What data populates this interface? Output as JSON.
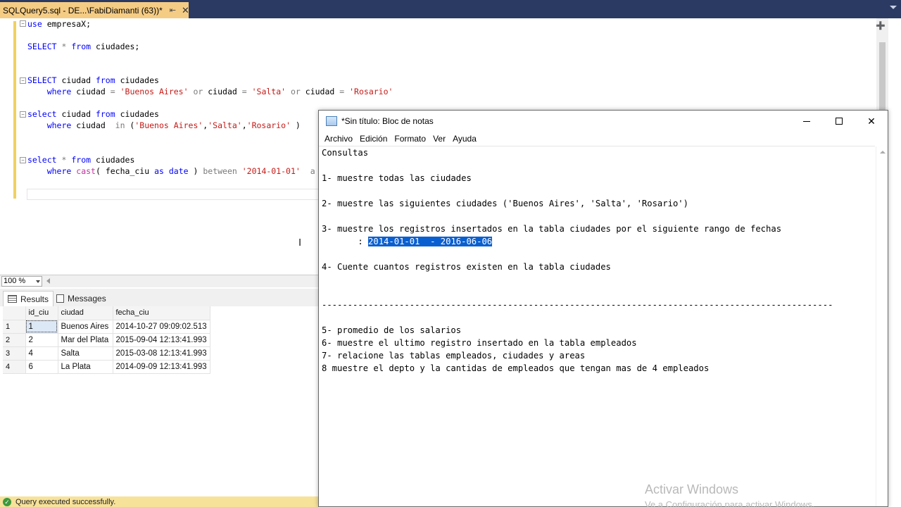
{
  "ssms": {
    "tab_title": "SQLQuery5.sql - DE...\\FabiDiamanti (63))*",
    "tab_pin": "⇤",
    "tab_close": "✕",
    "split_glyph": "➕",
    "code_lines": [
      "use empresaX;",
      "SELECT * from ciudades;",
      "SELECT ciudad from ciudades",
      "where ciudad = 'Buenos Aires' or ciudad = 'Salta' or ciudad = 'Rosario'",
      "select ciudad from ciudades",
      "where ciudad  in ('Buenos Aires','Salta','Rosario' )",
      "select * from ciudades",
      "where cast( fecha_ciu as date ) between '2014-01-01'  a"
    ],
    "zoom": "100 %",
    "results_tab": "Results",
    "messages_tab": "Messages",
    "grid": {
      "columns": [
        "id_ciu",
        "ciudad",
        "fecha_ciu"
      ],
      "rows": [
        {
          "n": "1",
          "id": "1",
          "ciudad": "Buenos Aires",
          "fecha": "2014-10-27 09:09:02.513"
        },
        {
          "n": "2",
          "id": "2",
          "ciudad": "Mar del Plata",
          "fecha": "2015-09-04 12:13:41.993"
        },
        {
          "n": "3",
          "id": "4",
          "ciudad": "Salta",
          "fecha": "2015-03-08 12:13:41.993"
        },
        {
          "n": "4",
          "id": "6",
          "ciudad": "La Plata",
          "fecha": "2014-09-09 12:13:41.993"
        }
      ]
    },
    "status": "Query executed successfully."
  },
  "notepad": {
    "title": "*Sin título: Bloc de notas",
    "menu": [
      "Archivo",
      "Edición",
      "Formato",
      "Ver",
      "Ayuda"
    ],
    "lines": [
      "Consultas",
      "",
      "1- muestre todas las ciudades",
      "",
      "2- muestre las siguientes ciudades ('Buenos Aires', 'Salta', 'Rosario')",
      "",
      "3- muestre los registros insertados en la tabla ciudades por el siguiente rango de fechas",
      "",
      "",
      "4- Cuente cuantos registros existen en la tabla ciudades",
      "",
      "",
      "---------------------------------------------------------------------------------------------------",
      "",
      "5- promedio de los salarios",
      "6- muestre el ultimo registro insertado en la tabla empleados",
      "7- relacione las tablas empleados, ciudades y areas",
      "8 muestre el depto y la cantidas de empleados que tengan mas de 4 empleados"
    ],
    "range_prefix": "       : ",
    "range_selected": "2014-01-01  - 2016-06-06",
    "window_close": "✕"
  },
  "watermark": {
    "line1": "Activar Windows",
    "line2": "Ve a Configuración para activar Windows."
  },
  "colors": {
    "keyword": "#0000ff",
    "string": "#c41a16",
    "tab_active": "#f5cc84",
    "selection": "#0a5fd0"
  }
}
